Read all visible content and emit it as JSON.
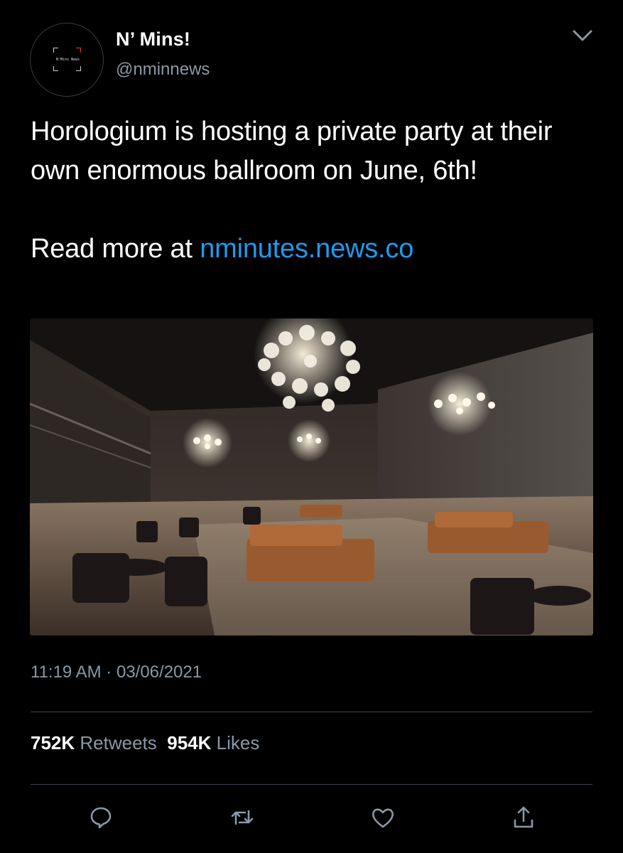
{
  "author": {
    "display_name": "N’ Mins!",
    "handle": "@nminnews",
    "avatar_text": "N'Mins News"
  },
  "tweet": {
    "line1": "Horologium is hosting a private party at their own enormous ballroom on June, 6th!",
    "read_more_prefix": "Read more at ",
    "link_text": "nminutes.news.co"
  },
  "meta": {
    "time": "11:19 AM",
    "separator": "·",
    "date": "03/06/2021"
  },
  "stats": {
    "retweets_count": "752K",
    "retweets_label": "Retweets",
    "likes_count": "954K",
    "likes_label": "Likes"
  },
  "icons": [
    "chevron-down-icon",
    "reply-icon",
    "retweet-icon",
    "like-icon",
    "share-icon"
  ],
  "colors": {
    "background": "#000000",
    "link": "#1d9bf0",
    "secondary_text": "#8b98a5",
    "divider": "#38444d"
  }
}
